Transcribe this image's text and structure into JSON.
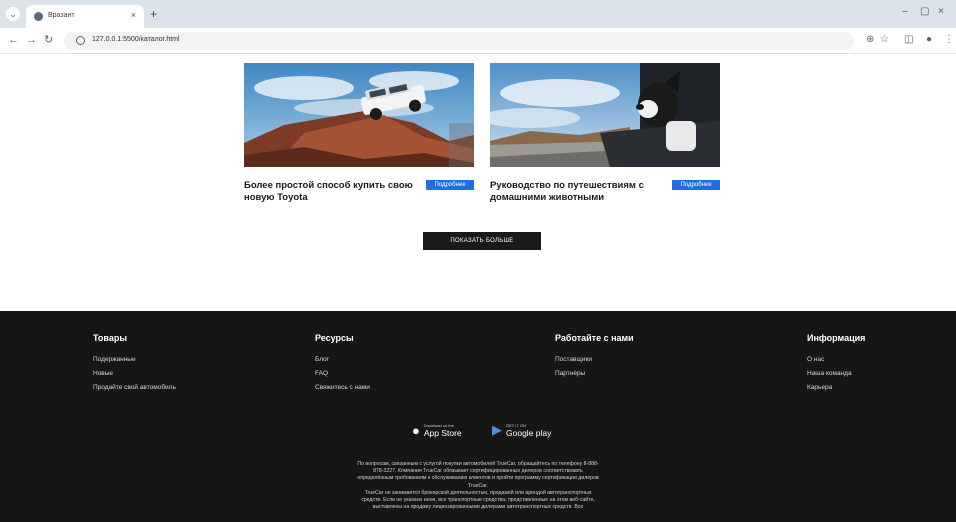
{
  "browser": {
    "tab_title": "Вразант",
    "tab_close": "×",
    "new_tab": "+",
    "url": "127.0.0.1:5500/каталог.html",
    "win_min": "–",
    "win_max": "▢",
    "win_close": "×"
  },
  "cards": [
    {
      "title": "Более простой способ купить свою новую Toyota",
      "button": "Подробнее"
    },
    {
      "title": "Руководство по путешествиям с домашними животными",
      "button": "Подробнее"
    }
  ],
  "more_button": "ПОКАЗАТЬ БОЛЬШЕ",
  "footer": {
    "columns": [
      {
        "title": "Товары",
        "links": [
          "Подержанные",
          "Новые",
          "Продайте свой автомобиль"
        ]
      },
      {
        "title": "Ресурсы",
        "links": [
          "Блог",
          "FAQ",
          "Свяжитесь с нами"
        ]
      },
      {
        "title": "Работайте с нами",
        "links": [
          "Поставщики",
          "Партнёры"
        ]
      },
      {
        "title": "Информация",
        "links": [
          "О нас",
          "Наша команда",
          "Карьера"
        ]
      }
    ],
    "app_store": {
      "small": "Download on the",
      "big": "App Store"
    },
    "google_play": {
      "small": "GET IT ON",
      "big": "Google play"
    },
    "legal": [
      "По вопросам, связанным с услугой покупки автомобилей TrueCar, обращайтесь по телефону 8-888-",
      "878-3227. Компания TrueCar обязывает сертифицированных дилеров соответствовать",
      "определённым требованиям к обслуживанию клиентов и пройти программу сертификации дилеров",
      "TrueCar.",
      "TrueCar не занимается брокерской деятельностью, продажей или арендой автотранспортных",
      "средств. Если не указано иное, все транспортные средства, представленные на этом веб-сайте,",
      "выставлены на продажу лицензированными дилерами автотранспортных средств. Все"
    ]
  },
  "colors": {
    "footer_bg": "#161616",
    "accent_blue": "#1f6fe0",
    "button_dark": "#1a1a1a"
  }
}
